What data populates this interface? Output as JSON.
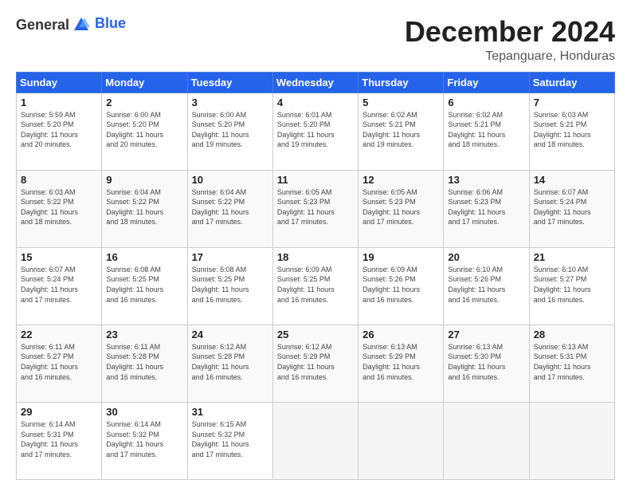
{
  "header": {
    "logo_general": "General",
    "logo_blue": "Blue",
    "month": "December 2024",
    "location": "Tepanguare, Honduras"
  },
  "days_of_week": [
    "Sunday",
    "Monday",
    "Tuesday",
    "Wednesday",
    "Thursday",
    "Friday",
    "Saturday"
  ],
  "weeks": [
    [
      {
        "day": "1",
        "info": "Sunrise: 5:59 AM\nSunset: 5:20 PM\nDaylight: 11 hours\nand 20 minutes."
      },
      {
        "day": "2",
        "info": "Sunrise: 6:00 AM\nSunset: 5:20 PM\nDaylight: 11 hours\nand 20 minutes."
      },
      {
        "day": "3",
        "info": "Sunrise: 6:00 AM\nSunset: 5:20 PM\nDaylight: 11 hours\nand 19 minutes."
      },
      {
        "day": "4",
        "info": "Sunrise: 6:01 AM\nSunset: 5:20 PM\nDaylight: 11 hours\nand 19 minutes."
      },
      {
        "day": "5",
        "info": "Sunrise: 6:02 AM\nSunset: 5:21 PM\nDaylight: 11 hours\nand 19 minutes."
      },
      {
        "day": "6",
        "info": "Sunrise: 6:02 AM\nSunset: 5:21 PM\nDaylight: 11 hours\nand 18 minutes."
      },
      {
        "day": "7",
        "info": "Sunrise: 6:03 AM\nSunset: 5:21 PM\nDaylight: 11 hours\nand 18 minutes."
      }
    ],
    [
      {
        "day": "8",
        "info": "Sunrise: 6:03 AM\nSunset: 5:22 PM\nDaylight: 11 hours\nand 18 minutes."
      },
      {
        "day": "9",
        "info": "Sunrise: 6:04 AM\nSunset: 5:22 PM\nDaylight: 11 hours\nand 18 minutes."
      },
      {
        "day": "10",
        "info": "Sunrise: 6:04 AM\nSunset: 5:22 PM\nDaylight: 11 hours\nand 17 minutes."
      },
      {
        "day": "11",
        "info": "Sunrise: 6:05 AM\nSunset: 5:23 PM\nDaylight: 11 hours\nand 17 minutes."
      },
      {
        "day": "12",
        "info": "Sunrise: 6:05 AM\nSunset: 5:23 PM\nDaylight: 11 hours\nand 17 minutes."
      },
      {
        "day": "13",
        "info": "Sunrise: 6:06 AM\nSunset: 5:23 PM\nDaylight: 11 hours\nand 17 minutes."
      },
      {
        "day": "14",
        "info": "Sunrise: 6:07 AM\nSunset: 5:24 PM\nDaylight: 11 hours\nand 17 minutes."
      }
    ],
    [
      {
        "day": "15",
        "info": "Sunrise: 6:07 AM\nSunset: 5:24 PM\nDaylight: 11 hours\nand 17 minutes."
      },
      {
        "day": "16",
        "info": "Sunrise: 6:08 AM\nSunset: 5:25 PM\nDaylight: 11 hours\nand 16 minutes."
      },
      {
        "day": "17",
        "info": "Sunrise: 6:08 AM\nSunset: 5:25 PM\nDaylight: 11 hours\nand 16 minutes."
      },
      {
        "day": "18",
        "info": "Sunrise: 6:09 AM\nSunset: 5:25 PM\nDaylight: 11 hours\nand 16 minutes."
      },
      {
        "day": "19",
        "info": "Sunrise: 6:09 AM\nSunset: 5:26 PM\nDaylight: 11 hours\nand 16 minutes."
      },
      {
        "day": "20",
        "info": "Sunrise: 6:10 AM\nSunset: 5:26 PM\nDaylight: 11 hours\nand 16 minutes."
      },
      {
        "day": "21",
        "info": "Sunrise: 6:10 AM\nSunset: 5:27 PM\nDaylight: 11 hours\nand 16 minutes."
      }
    ],
    [
      {
        "day": "22",
        "info": "Sunrise: 6:11 AM\nSunset: 5:27 PM\nDaylight: 11 hours\nand 16 minutes."
      },
      {
        "day": "23",
        "info": "Sunrise: 6:11 AM\nSunset: 5:28 PM\nDaylight: 11 hours\nand 16 minutes."
      },
      {
        "day": "24",
        "info": "Sunrise: 6:12 AM\nSunset: 5:28 PM\nDaylight: 11 hours\nand 16 minutes."
      },
      {
        "day": "25",
        "info": "Sunrise: 6:12 AM\nSunset: 5:29 PM\nDaylight: 11 hours\nand 16 minutes."
      },
      {
        "day": "26",
        "info": "Sunrise: 6:13 AM\nSunset: 5:29 PM\nDaylight: 11 hours\nand 16 minutes."
      },
      {
        "day": "27",
        "info": "Sunrise: 6:13 AM\nSunset: 5:30 PM\nDaylight: 11 hours\nand 16 minutes."
      },
      {
        "day": "28",
        "info": "Sunrise: 6:13 AM\nSunset: 5:31 PM\nDaylight: 11 hours\nand 17 minutes."
      }
    ],
    [
      {
        "day": "29",
        "info": "Sunrise: 6:14 AM\nSunset: 5:31 PM\nDaylight: 11 hours\nand 17 minutes."
      },
      {
        "day": "30",
        "info": "Sunrise: 6:14 AM\nSunset: 5:32 PM\nDaylight: 11 hours\nand 17 minutes."
      },
      {
        "day": "31",
        "info": "Sunrise: 6:15 AM\nSunset: 5:32 PM\nDaylight: 11 hours\nand 17 minutes."
      },
      {
        "day": "",
        "info": ""
      },
      {
        "day": "",
        "info": ""
      },
      {
        "day": "",
        "info": ""
      },
      {
        "day": "",
        "info": ""
      }
    ]
  ]
}
